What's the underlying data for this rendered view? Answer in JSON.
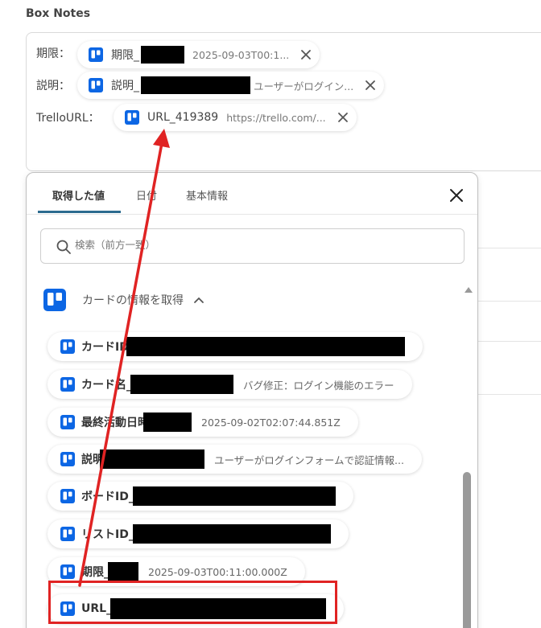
{
  "section": {
    "title": "Box Notes"
  },
  "fields": [
    {
      "label": "期限：",
      "chip_name": "期限_",
      "chip_value": "2025-09-03T00:1..."
    },
    {
      "label": "説明：",
      "chip_name": "説明_",
      "chip_value": "ユーザーがログイン..."
    },
    {
      "label": "TrelloURL：",
      "chip_name": "URL_419389",
      "chip_value": "https://trello.com/..."
    }
  ],
  "panel": {
    "tabs": [
      "取得した値",
      "日付",
      "基本情報"
    ],
    "active_tab": 0,
    "search": {
      "placeholder": "検索（前方一致）"
    },
    "group": {
      "title": "カードの情報を取得"
    },
    "items": [
      {
        "name": "カードID_",
        "value": ""
      },
      {
        "name": "カード名_",
        "value": "バグ修正：ログイン機能のエラー"
      },
      {
        "name": "最終活動日時_",
        "value": "2025-09-02T02:07:44.851Z"
      },
      {
        "name": "説明_",
        "value": "ユーザーがログインフォームで認証情報..."
      },
      {
        "name": "ボードID_",
        "value": ""
      },
      {
        "name": "リストID_",
        "value": ""
      },
      {
        "name": "期限_",
        "value": "2025-09-03T00:11:00.000Z"
      },
      {
        "name": "URL_",
        "value": ""
      }
    ]
  },
  "colors": {
    "trello_blue": "#0c66e4",
    "tab_indicator": "#2c6b8f",
    "annotation_red": "#e02323"
  }
}
